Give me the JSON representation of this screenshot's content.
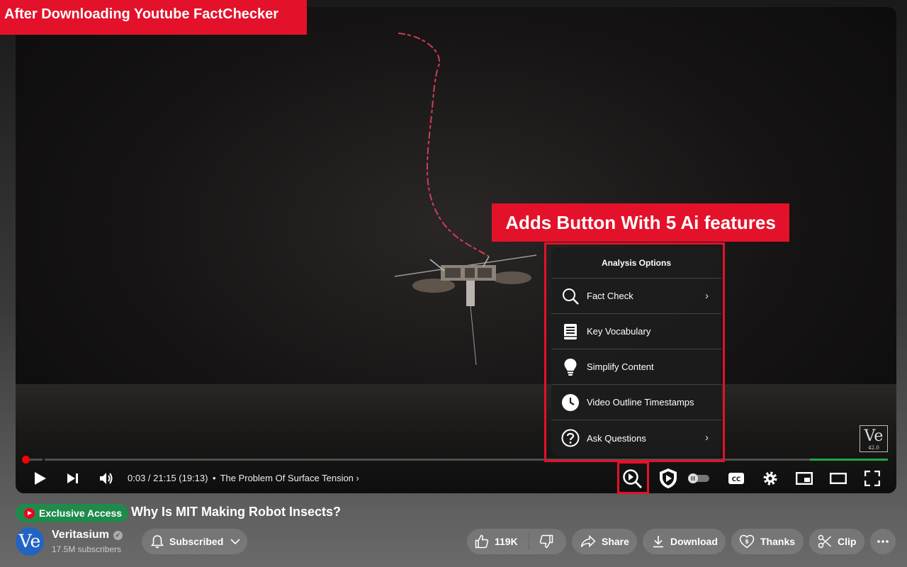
{
  "banner": {
    "text": "After Downloading Youtube FactChecker"
  },
  "callout": {
    "text": "Adds Button With 5 Ai features"
  },
  "player": {
    "time": "0:03 / 21:15 (19:13)",
    "chapter": "The Problem Of Surface Tension",
    "progress_fraction": 0.002,
    "watermark": {
      "logo": "Ve",
      "version": "42.0"
    }
  },
  "analysis_menu": {
    "title": "Analysis Options",
    "items": [
      {
        "label": "Fact Check",
        "icon": "search-icon",
        "has_submenu": true
      },
      {
        "label": "Key Vocabulary",
        "icon": "book-icon",
        "has_submenu": false
      },
      {
        "label": "Simplify Content",
        "icon": "lightbulb-icon",
        "has_submenu": false
      },
      {
        "label": "Video Outline Timestamps",
        "icon": "clock-icon",
        "has_submenu": false
      },
      {
        "label": "Ask Questions",
        "icon": "question-icon",
        "has_submenu": true
      }
    ]
  },
  "video": {
    "badge": "Exclusive Access",
    "title": "Why Is MIT Making Robot Insects?"
  },
  "channel": {
    "avatar_text": "Ve",
    "name": "Veritasium",
    "subscribers": "17.5M subscribers"
  },
  "actions": {
    "subscribe": "Subscribed",
    "likes": "119K",
    "share": "Share",
    "download": "Download",
    "thanks": "Thanks",
    "clip": "Clip"
  },
  "colors": {
    "highlight": "#e3122a",
    "progress_played": "#ff0000",
    "badge_green": "#1f8a4c",
    "avatar_blue": "#2264c4"
  }
}
